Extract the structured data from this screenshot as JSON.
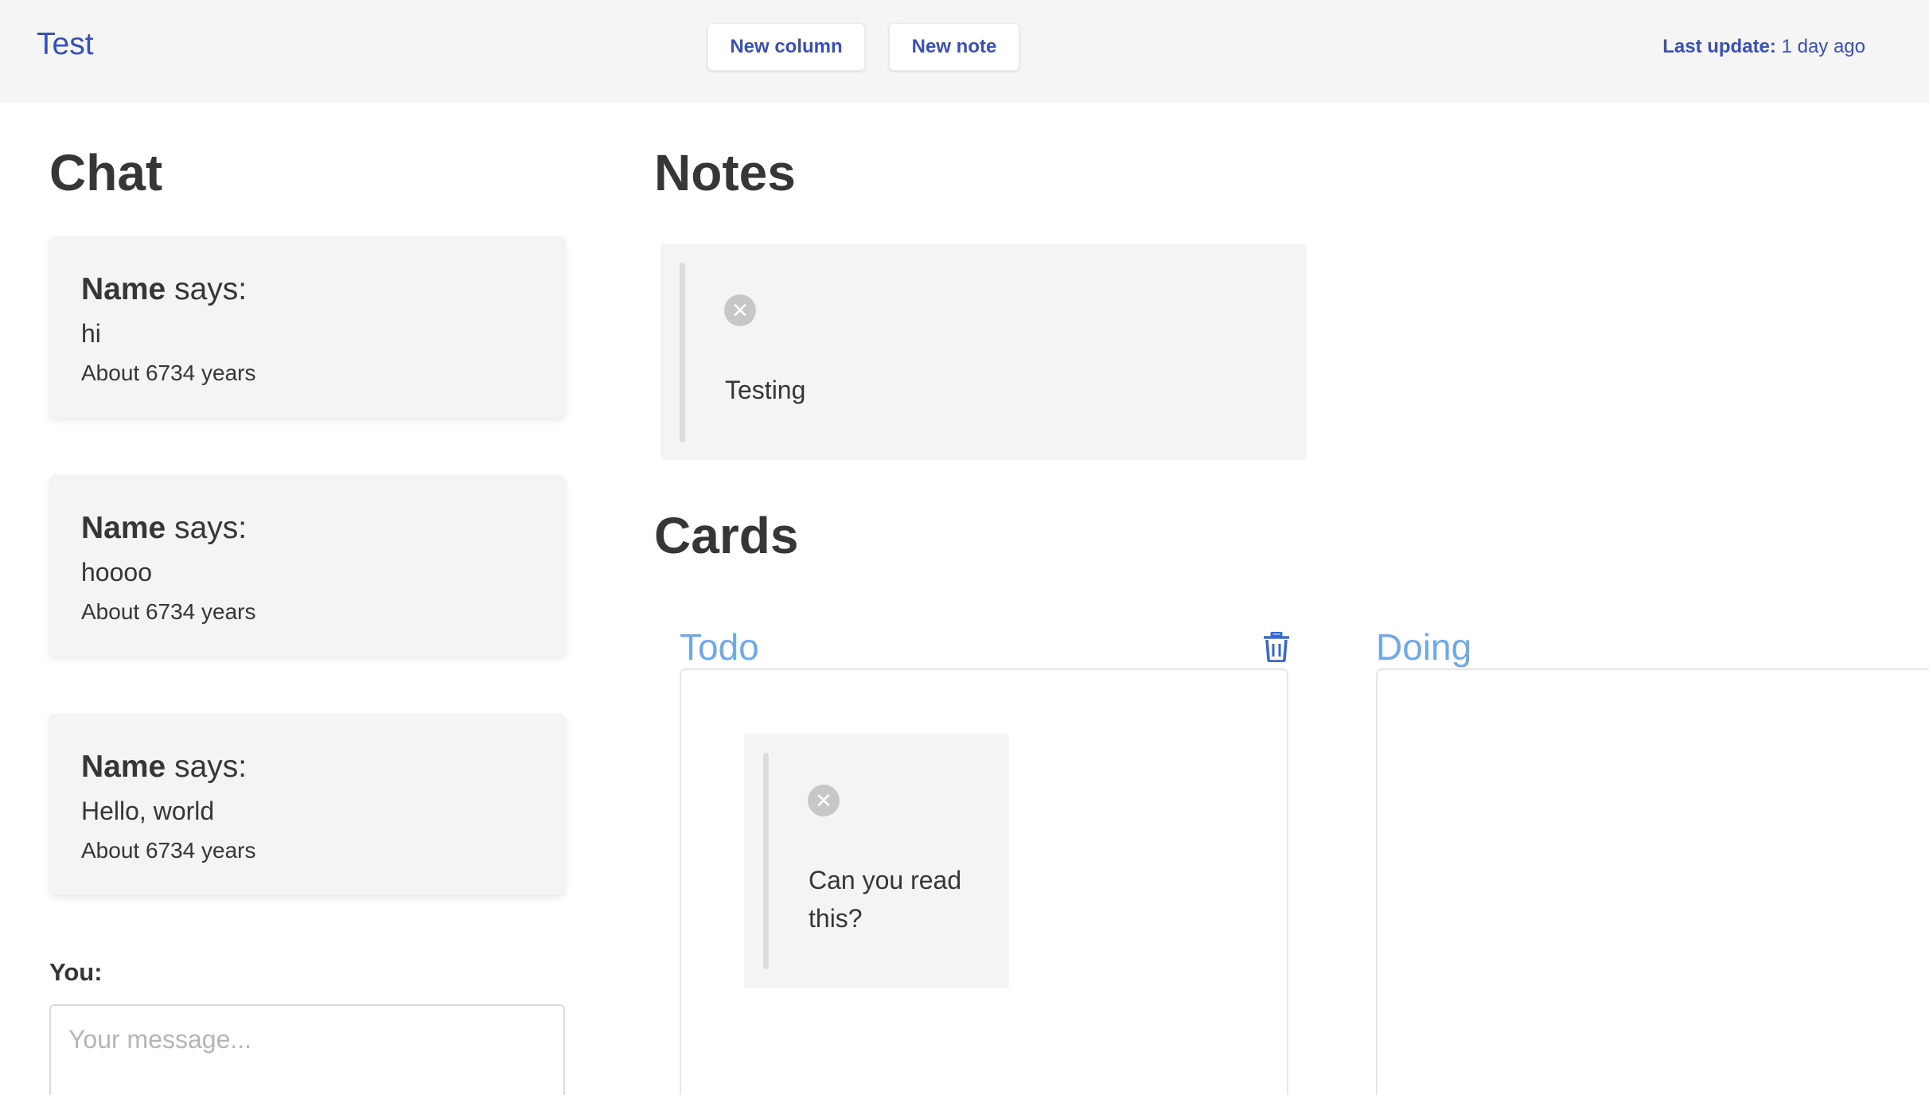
{
  "header": {
    "brand": "Test",
    "new_column_label": "New column",
    "new_note_label": "New note",
    "last_update_label": "Last update:",
    "last_update_value": "1 day ago"
  },
  "chat": {
    "title": "Chat",
    "messages": [
      {
        "name": "Name",
        "says": "says:",
        "text": "hi",
        "time": "About 6734 years"
      },
      {
        "name": "Name",
        "says": "says:",
        "text": "hoooo",
        "time": "About 6734 years"
      },
      {
        "name": "Name",
        "says": "says:",
        "text": "Hello, world",
        "time": "About 6734 years"
      }
    ],
    "you_label": "You:",
    "input_placeholder": "Your message..."
  },
  "notes": {
    "title": "Notes",
    "items": [
      {
        "text": "Testing",
        "close_glyph": "✕"
      }
    ]
  },
  "cards": {
    "title": "Cards",
    "columns": [
      {
        "title": "Todo",
        "cards": [
          {
            "text": "Can you read this?",
            "close_glyph": "✕"
          }
        ]
      },
      {
        "title": "Doing",
        "cards": []
      }
    ]
  },
  "colors": {
    "accent": "#3850b7",
    "column_title": "#6fa9ea",
    "panel_bg": "#f4f4f4",
    "topbar_bg": "#f5f5f5"
  },
  "icons": {
    "close": "close-circle-icon",
    "trash": "trash-icon"
  }
}
